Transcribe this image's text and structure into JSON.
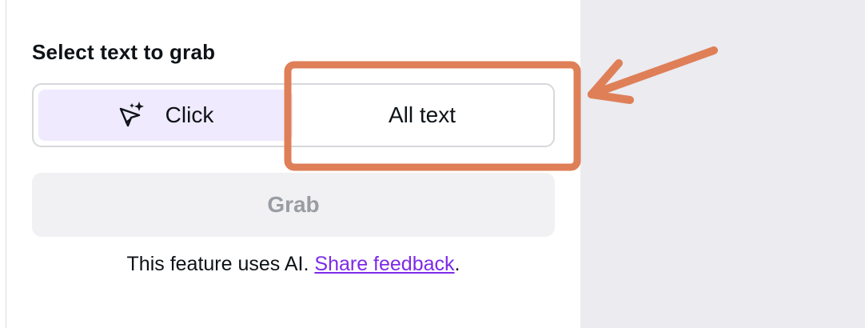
{
  "panel": {
    "title": "Select text to grab",
    "mode_toggle": {
      "options": [
        {
          "label": "Click",
          "icon": "sparkle-cursor-icon",
          "selected": true
        },
        {
          "label": "All text",
          "selected": false
        }
      ]
    },
    "grab_button": {
      "label": "Grab",
      "enabled": false
    },
    "footer": {
      "text": "This feature uses AI.",
      "link_text": "Share feedback",
      "suffix": "."
    }
  },
  "annotation": {
    "highlight": "All text",
    "color": "#df7f57"
  },
  "colors": {
    "selected_option_bg": "#efeafe",
    "link": "#7d2ae8",
    "disabled_text": "#9a9ca3",
    "canvas_bg": "#ebebf0"
  }
}
